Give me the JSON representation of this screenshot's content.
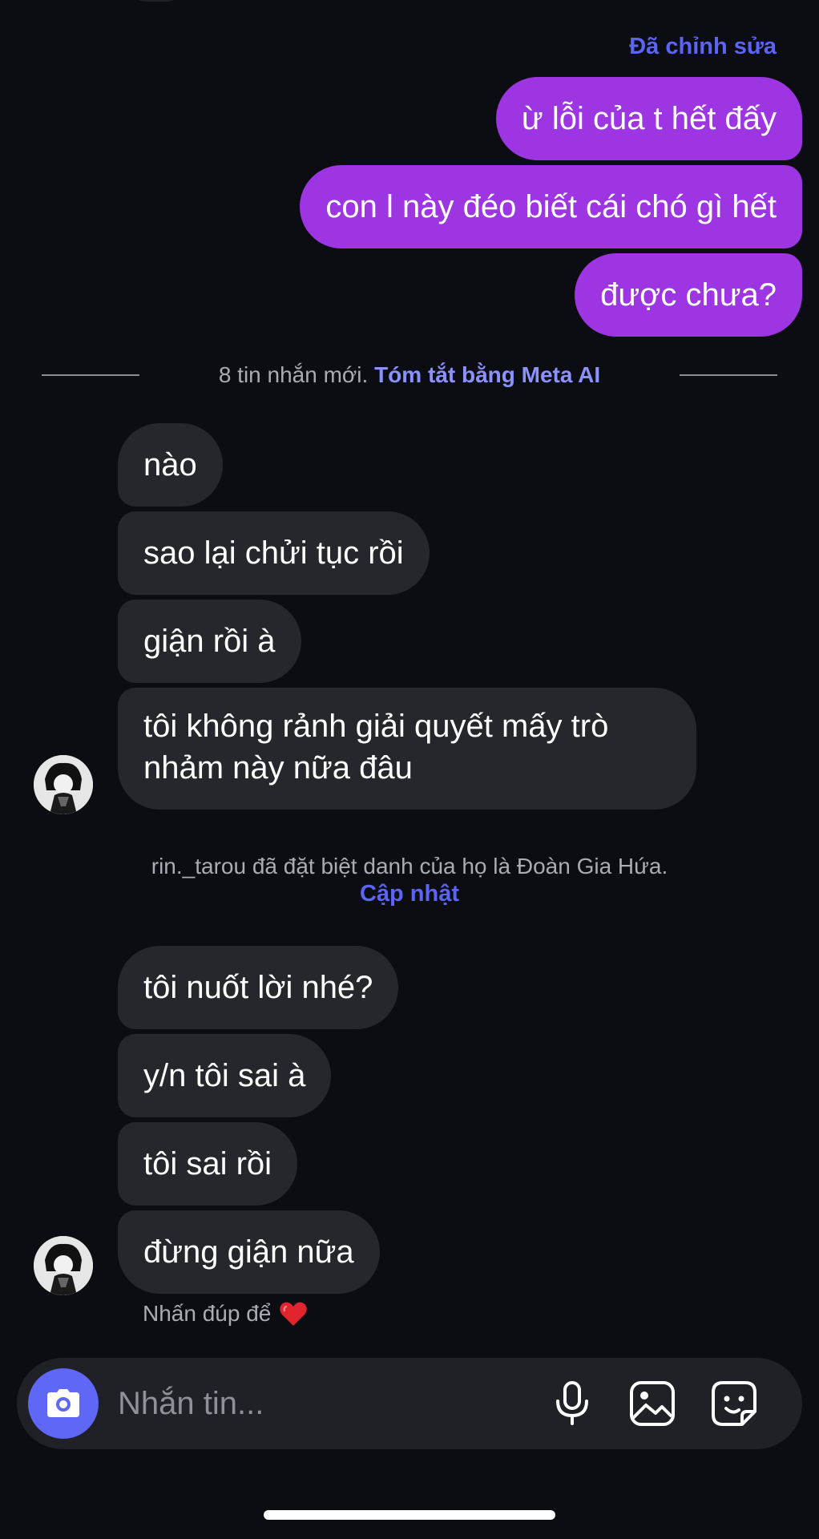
{
  "thread": {
    "edited_label": "Đã chỉnh sửa",
    "sent_messages": [
      "ừ lỗi của t hết đấy",
      "con l này đéo biết cái chó gì hết",
      "được chưa?"
    ],
    "new_messages_divider": {
      "count_text": "8 tin nhắn mới.",
      "summary_link": "Tóm tắt bằng Meta AI"
    },
    "received_group_1": [
      "nào",
      "sao lại chửi tục rồi",
      "giận rồi à",
      "tôi không rảnh giải quyết mấy trò nhảm này nữa đâu"
    ],
    "system_notice": {
      "text": "rin._tarou đã đặt biệt danh của họ là Đoàn Gia Hứa.",
      "link": "Cập nhật"
    },
    "received_group_2": [
      "tôi nuốt lời nhé?",
      "y/n tôi sai à",
      "tôi sai rồi",
      "đừng giận nữa"
    ],
    "double_tap_hint": "Nhấn đúp để",
    "hint_icon": "heart-icon"
  },
  "composer": {
    "placeholder": "Nhắn tin...",
    "camera_icon": "camera-icon",
    "mic_icon": "microphone-icon",
    "gallery_icon": "image-icon",
    "sticker_icon": "sticker-icon"
  },
  "colors": {
    "background": "#0b0d12",
    "sent_bubble": "#9d35e3",
    "received_bubble": "#25272c",
    "accent": "#5b64f5",
    "camera_button": "#5f67f7"
  }
}
